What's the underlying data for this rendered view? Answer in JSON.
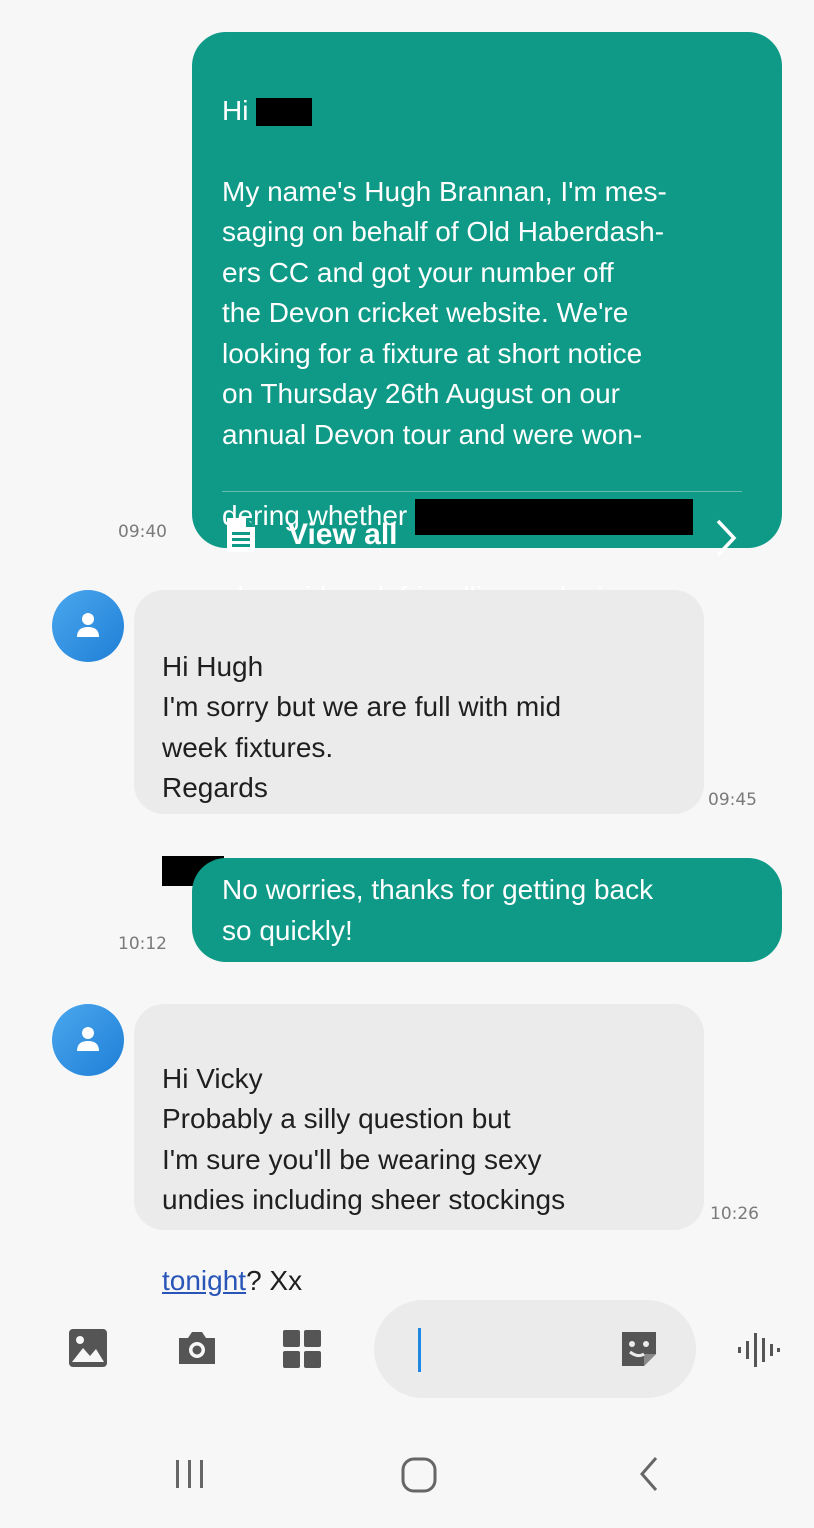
{
  "messages": [
    {
      "direction": "outgoing",
      "time": "09:40",
      "greeting": "Hi",
      "body": "My name's Hugh Brannan, I'm mes-\nsaging on behalf of Old Haberdash-\ners CC and got your number off\nthe Devon cricket website. We're\nlooking for a fixture at short notice\non Thursday 26th August on our\nannual Devon tour and were won-",
      "line_before_redaction": "dering whether",
      "last_line": "play midweek friendlies and mig",
      "view_all_label": "View all"
    },
    {
      "direction": "incoming",
      "time": "09:45",
      "body": "Hi Hugh\nI'm sorry but we are full with mid\nweek fixtures.\nRegards"
    },
    {
      "direction": "outgoing",
      "time": "10:12",
      "body": "No worries, thanks for getting back\nso quickly!"
    },
    {
      "direction": "incoming",
      "time": "10:26",
      "body": "Hi Vicky\nProbably a silly question but\nI'm sure you'll be wearing sexy\nundies including sheer stockings",
      "link_text": "tonight",
      "after_link": "? Xx"
    }
  ],
  "composer": {
    "placeholder": "",
    "icons": [
      "gallery-icon",
      "camera-icon",
      "apps-icon",
      "sticker-icon",
      "voice-icon"
    ]
  },
  "colors": {
    "outgoing_bubble": "#0e9a86",
    "incoming_bubble": "#ebebeb",
    "link": "#2a55b8"
  }
}
